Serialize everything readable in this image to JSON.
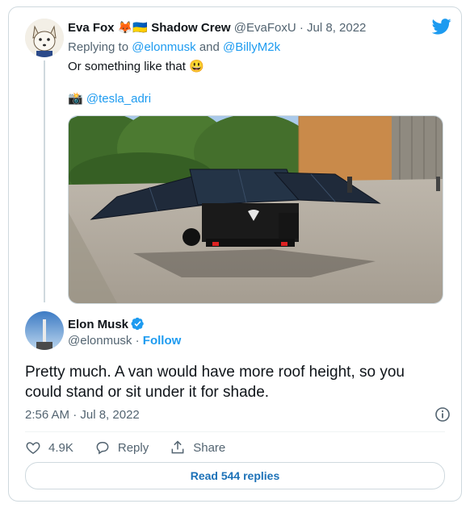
{
  "parent_tweet": {
    "display_name": "Eva Fox",
    "name_badges": "🦊🇺🇦 Shadow Crew",
    "handle": "@EvaFoxU",
    "separator": "·",
    "date": "Jul 8, 2022",
    "replying_prefix": "Replying to",
    "reply_to_1": "@elonmusk",
    "reply_and": "and",
    "reply_to_2": "@BillyM2k",
    "text": "Or something like that 😃",
    "credit_icon": "📸",
    "credit_handle": "@tesla_adri"
  },
  "main_tweet": {
    "display_name": "Elon Musk",
    "handle": "@elonmusk",
    "separator": "·",
    "follow_label": "Follow",
    "text": "Pretty much. A van would have more roof height, so you could stand or sit under it for shade.",
    "timestamp": "2:56 AM · Jul 8, 2022",
    "likes": "4.9K",
    "reply_label": "Reply",
    "share_label": "Share",
    "read_replies_label": "Read 544 replies"
  },
  "colors": {
    "accent": "#1d9bf0",
    "border": "#cfd9de",
    "muted": "#536471"
  },
  "icons": [
    "twitter-bird-icon",
    "verified-icon",
    "info-icon",
    "heart-icon",
    "reply-icon",
    "share-icon"
  ]
}
